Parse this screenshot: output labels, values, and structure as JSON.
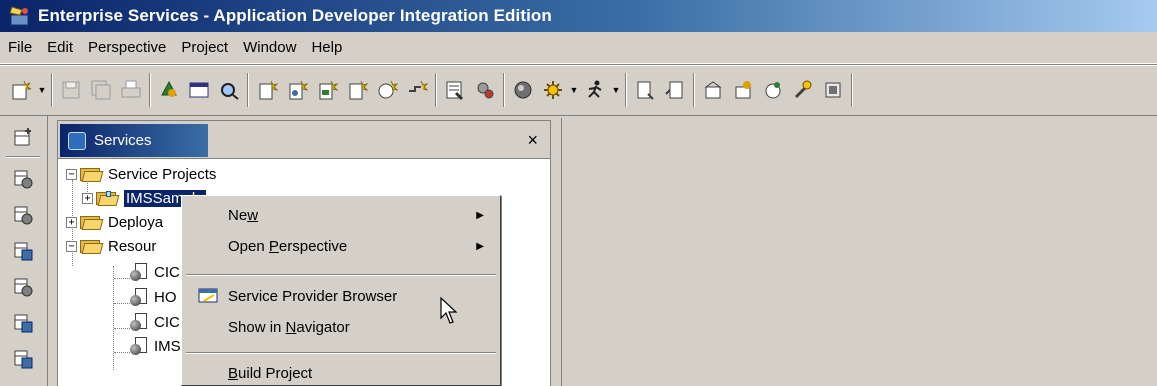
{
  "window": {
    "title": "Enterprise Services - Application Developer Integration Edition",
    "icon": "workbench-icon"
  },
  "menubar": {
    "items": [
      "File",
      "Edit",
      "Perspective",
      "Project",
      "Window",
      "Help"
    ]
  },
  "toolbar": {
    "buttons": [
      "new-wizard-icon",
      "save-icon",
      "save-all-icon",
      "print-icon",
      "open-type-icon",
      "open-editor-icon",
      "search-icon",
      "new-service-icon",
      "new-service-2-icon",
      "new-service-3-icon",
      "new-service-4-icon",
      "new-service-5-icon",
      "new-service-6-icon",
      "build-icon",
      "generate-icon",
      "server-icon",
      "debug-icon",
      "run-icon",
      "new-file-icon",
      "new-file-2-icon",
      "deploy-icon",
      "deploy-2-icon",
      "deploy-3-icon",
      "deploy-4-icon",
      "deploy-5-icon"
    ]
  },
  "shortcuts": {
    "items": [
      "open-perspective-icon",
      "perspective-1-icon",
      "perspective-2-icon",
      "perspective-3-icon",
      "perspective-4-icon",
      "perspective-5-icon",
      "perspective-6-icon"
    ]
  },
  "services_view": {
    "title": "Services",
    "close": "×",
    "tree": {
      "service_projects": "Service Projects",
      "ims_sample": "IMSSample",
      "deployable": "Deploya",
      "resources": "Resour",
      "children": [
        "CIC",
        "HO",
        "CIC",
        "IMS"
      ]
    }
  },
  "context_menu": {
    "items": [
      {
        "label": "New",
        "mnemonic": "w",
        "submenu": true
      },
      {
        "label": "Open Perspective",
        "mnemonic": "P",
        "submenu": true
      },
      {
        "label": "Service Provider Browser",
        "icon": "service-provider-browser-icon"
      },
      {
        "label": "Show in Navigator",
        "mnemonic": "N"
      },
      {
        "label": "Build Project",
        "mnemonic": "B"
      }
    ]
  },
  "colors": {
    "titlebar_start": "#0a246a",
    "titlebar_end": "#a6caf0",
    "window_bg": "#d4d0c8",
    "selection": "#0a246a"
  }
}
